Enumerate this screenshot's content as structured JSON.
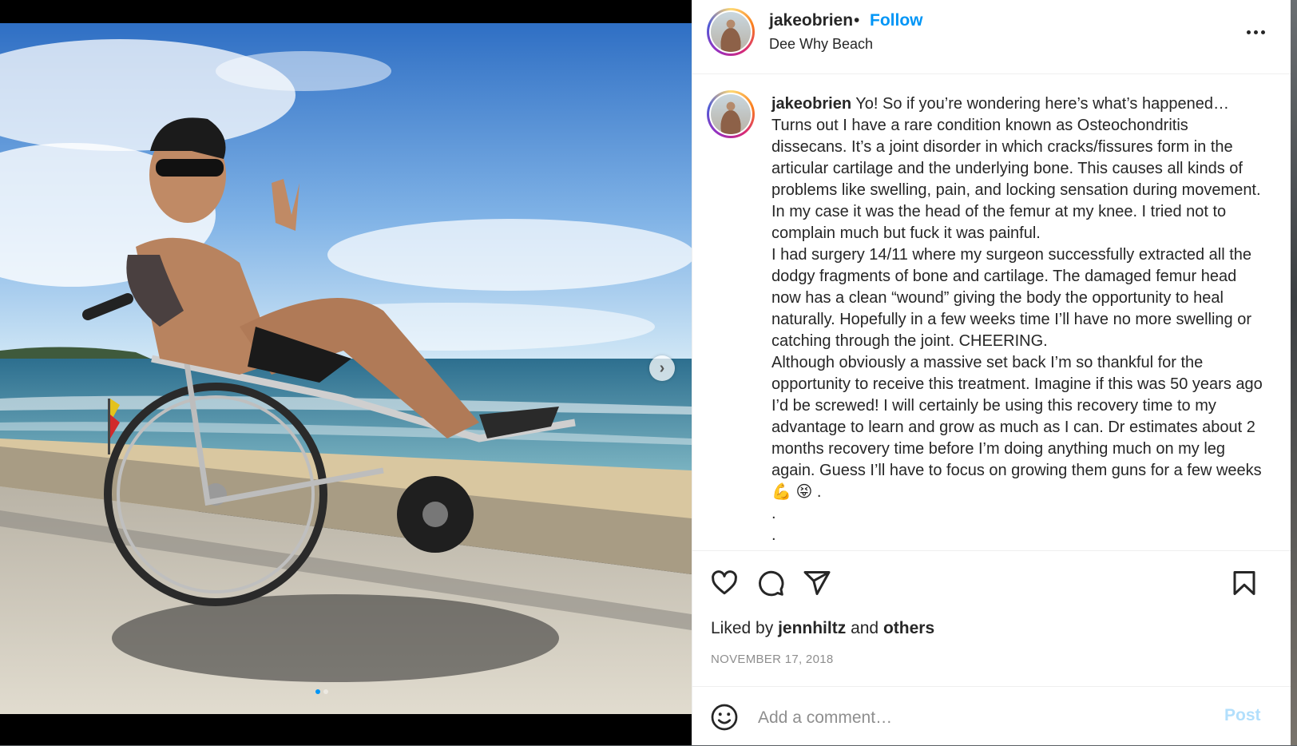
{
  "post": {
    "username": "jakeobrien",
    "separator": "•",
    "follow_label": "Follow",
    "location": "Dee Why Beach",
    "more_icon": "more-horizontal-icon",
    "next_icon": "chevron-right-icon",
    "carousel": {
      "count": 2,
      "active": 1
    }
  },
  "caption": {
    "username": "jakeobrien",
    "text": " Yo! So if you’re wondering here’s what’s happened… Turns out I have a rare condition known as Osteochondritis dissecans. It’s a joint disorder in which cracks/fissures form in the articular cartilage and the underlying bone. This causes all kinds of problems like swelling, pain, and locking sensation during movement. In my case it was the head of the femur at my knee. I tried not to complain much but fuck it was painful.\nI had surgery 14/11 where my surgeon successfully extracted all the dodgy fragments of bone and cartilage. The damaged femur head now has a clean “wound” giving the body the opportunity to heal naturally. Hopefully in a few weeks time I’ll have no more swelling or catching through the joint. CHEERING.\nAlthough obviously a massive set back I’m so thankful for the opportunity to receive this treatment. Imagine if this was 50 years ago I’d be screwed! I will certainly be using this recovery time to my advantage to learn and grow as much as I can. Dr estimates about 2 months recovery time before I’m doing anything much on my leg again. Guess I’ll have to focus on growing them guns for a few weeks 💪 😝 .\n.\n."
  },
  "actions": {
    "like_icon": "heart-icon",
    "comment_icon": "comment-icon",
    "share_icon": "send-icon",
    "save_icon": "bookmark-icon"
  },
  "likes": {
    "prefix": "Liked by ",
    "user": "jennhiltz",
    "middle": " and ",
    "others": "others"
  },
  "date": "NOVEMBER 17, 2018",
  "comment": {
    "emoji_icon": "smiley-icon",
    "placeholder": "Add a comment…",
    "post_label": "Post"
  },
  "colors": {
    "accent": "#0095f6",
    "post_disabled": "#b2dffc",
    "muted": "#8e8e8e",
    "text": "#262626"
  }
}
